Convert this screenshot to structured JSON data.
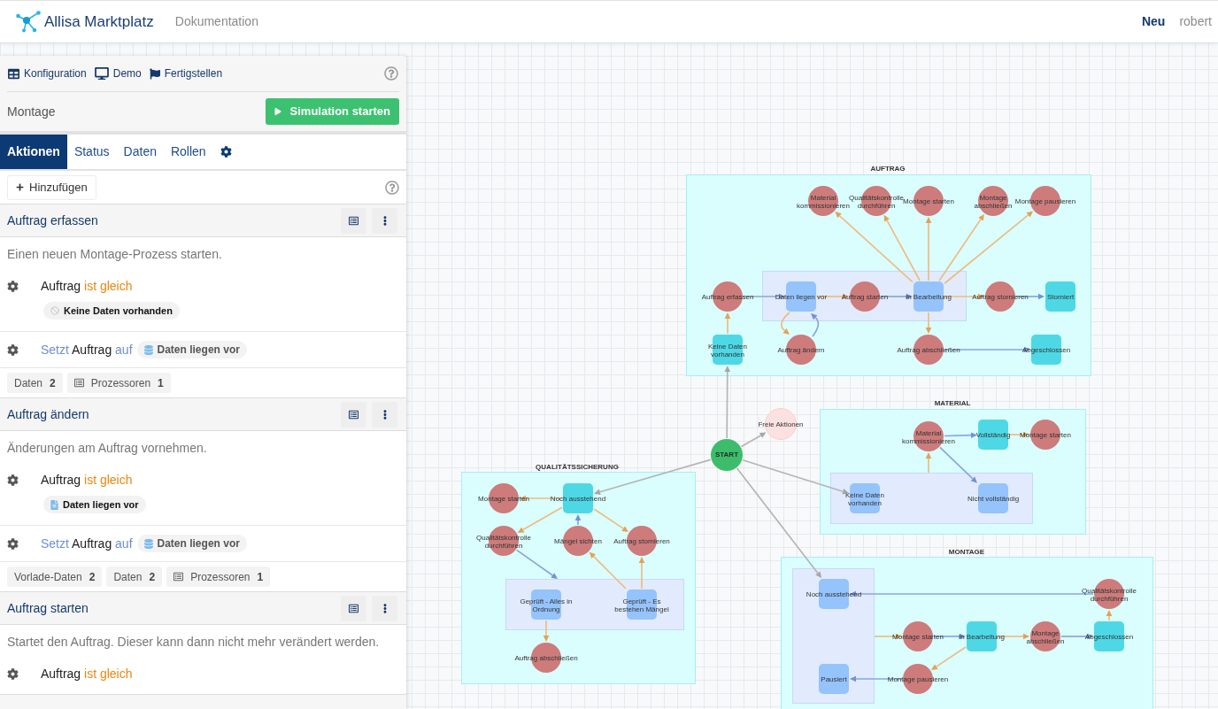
{
  "header": {
    "brand": "Allisa Marktplatz",
    "links": [
      "Dokumentation"
    ],
    "actions": [
      {
        "label": "Neu",
        "kind": "primary"
      },
      {
        "label": "robert",
        "kind": "user"
      }
    ]
  },
  "panel": {
    "toolbar": [
      {
        "label": "Konfiguration",
        "kind": "configuration"
      },
      {
        "label": "Demo",
        "kind": "demo"
      },
      {
        "label": "Fertigstellen",
        "kind": "finish"
      }
    ],
    "process_name": "Montage",
    "simulate_button": "Simulation starten",
    "tabs": [
      {
        "label": "Aktionen",
        "selected": true
      },
      {
        "label": "Status",
        "selected": false
      },
      {
        "label": "Daten",
        "selected": false
      },
      {
        "label": "Rollen",
        "selected": false
      }
    ],
    "add_button": "Hinzufügen",
    "actions": [
      {
        "title": "Auftrag erfassen",
        "description": "Einen neuen Montage-Prozess starten.",
        "condition": {
          "subject": "Auftrag",
          "operator": "ist gleich",
          "value": {
            "label": "Keine Daten vorhanden",
            "kind": "empty"
          }
        },
        "effect": {
          "verb": "Setzt",
          "subject": "Auftrag",
          "preposition": "auf",
          "value": {
            "label": "Daten liegen vor",
            "kind": "data"
          }
        },
        "counters": [
          {
            "label": "Daten",
            "count": "2",
            "kind": "data"
          },
          {
            "label": "Prozessoren",
            "count": "1",
            "kind": "processors"
          }
        ]
      },
      {
        "title": "Auftrag ändern",
        "description": "Änderungen am Auftrag vornehmen.",
        "condition": {
          "subject": "Auftrag",
          "operator": "ist gleich",
          "value": {
            "label": "Daten liegen vor",
            "kind": "data"
          }
        },
        "effect": {
          "verb": "Setzt",
          "subject": "Auftrag",
          "preposition": "auf",
          "value": {
            "label": "Daten liegen vor",
            "kind": "data"
          }
        },
        "counters": [
          {
            "label": "Vorlade-Daten",
            "count": "2",
            "kind": "data"
          },
          {
            "label": "Daten",
            "count": "2",
            "kind": "data"
          },
          {
            "label": "Prozessoren",
            "count": "1",
            "kind": "processors"
          }
        ]
      },
      {
        "title": "Auftrag starten",
        "description": "Startet den Auftrag. Dieser kann dann nicht mehr verändert werden.",
        "condition": {
          "subject": "Auftrag",
          "operator": "ist gleich"
        }
      }
    ]
  },
  "diagram": {
    "groups": [
      {
        "title": "AUFTRAG",
        "nodes": [
          {
            "label_lines": [
              "Material",
              "kommissionieren"
            ],
            "kind": "action"
          },
          {
            "label_lines": [
              "Qualitätskontrolle",
              "durchführen"
            ],
            "kind": "action"
          },
          {
            "label": "Montage starten",
            "kind": "action"
          },
          {
            "label_lines": [
              "Montage",
              "abschließen"
            ],
            "kind": "action"
          },
          {
            "label": "Montage pausieren",
            "kind": "action"
          },
          {
            "label": "Auftrag erfassen",
            "kind": "action"
          },
          {
            "label": "Daten liegen vor",
            "kind": "set_state"
          },
          {
            "label": "Auftrag starten",
            "kind": "action"
          },
          {
            "label": "In Bearbeitung",
            "kind": "set_state"
          },
          {
            "label": "Auftrag stornieren",
            "kind": "action"
          },
          {
            "label": "Storniert",
            "kind": "state"
          },
          {
            "label_lines": [
              "Keine Daten",
              "vorhanden"
            ],
            "kind": "state"
          },
          {
            "label": "Auftrag ändern",
            "kind": "action"
          },
          {
            "label": "Auftrag abschließen",
            "kind": "action"
          },
          {
            "label": "Abgeschlossen",
            "kind": "state"
          }
        ]
      },
      {
        "title": "MATERIAL",
        "nodes": [
          {
            "label_lines": [
              "Material",
              "kommissionieren"
            ],
            "kind": "action"
          },
          {
            "label": "Vollständig",
            "kind": "state"
          },
          {
            "label": "Montage starten",
            "kind": "action"
          },
          {
            "label_lines": [
              "Keine Daten",
              "vorhanden"
            ],
            "kind": "set_state"
          },
          {
            "label": "Nicht vollständig",
            "kind": "set_state"
          }
        ]
      },
      {
        "title": "QUALITÄTSSICHERUNG",
        "nodes": [
          {
            "label": "Montage starten",
            "kind": "action"
          },
          {
            "label": "Noch ausstehend",
            "kind": "state"
          },
          {
            "label_lines": [
              "Qualitätskontrolle",
              "durchführen"
            ],
            "kind": "action"
          },
          {
            "label": "Mängel sichten",
            "kind": "action"
          },
          {
            "label": "Auftrag stornieren",
            "kind": "action"
          },
          {
            "label_lines": [
              "Geprüft - Alles in",
              "Ordnung"
            ],
            "kind": "set_state"
          },
          {
            "label_lines": [
              "Geprüft - Es",
              "bestehen Mängel"
            ],
            "kind": "set_state"
          },
          {
            "label": "Auftrag abschließen",
            "kind": "action"
          }
        ]
      },
      {
        "title": "MONTAGE",
        "nodes": [
          {
            "label": "Noch ausstehend",
            "kind": "set_state"
          },
          {
            "label_lines": [
              "Qualitätskontrolle",
              "durchführen"
            ],
            "kind": "action"
          },
          {
            "label": "Montage starten",
            "kind": "action"
          },
          {
            "label": "In Bearbeitung",
            "kind": "state"
          },
          {
            "label_lines": [
              "Montage",
              "abschließen"
            ],
            "kind": "action"
          },
          {
            "label": "Abgeschlossen",
            "kind": "state"
          },
          {
            "label": "Pausiert",
            "kind": "set_state"
          },
          {
            "label": "Montage pausieren",
            "kind": "action"
          }
        ]
      }
    ],
    "nodes": [
      {
        "label": "Freie Aktionen",
        "kind": "free"
      },
      {
        "label": "START",
        "kind": "start"
      }
    ]
  }
}
